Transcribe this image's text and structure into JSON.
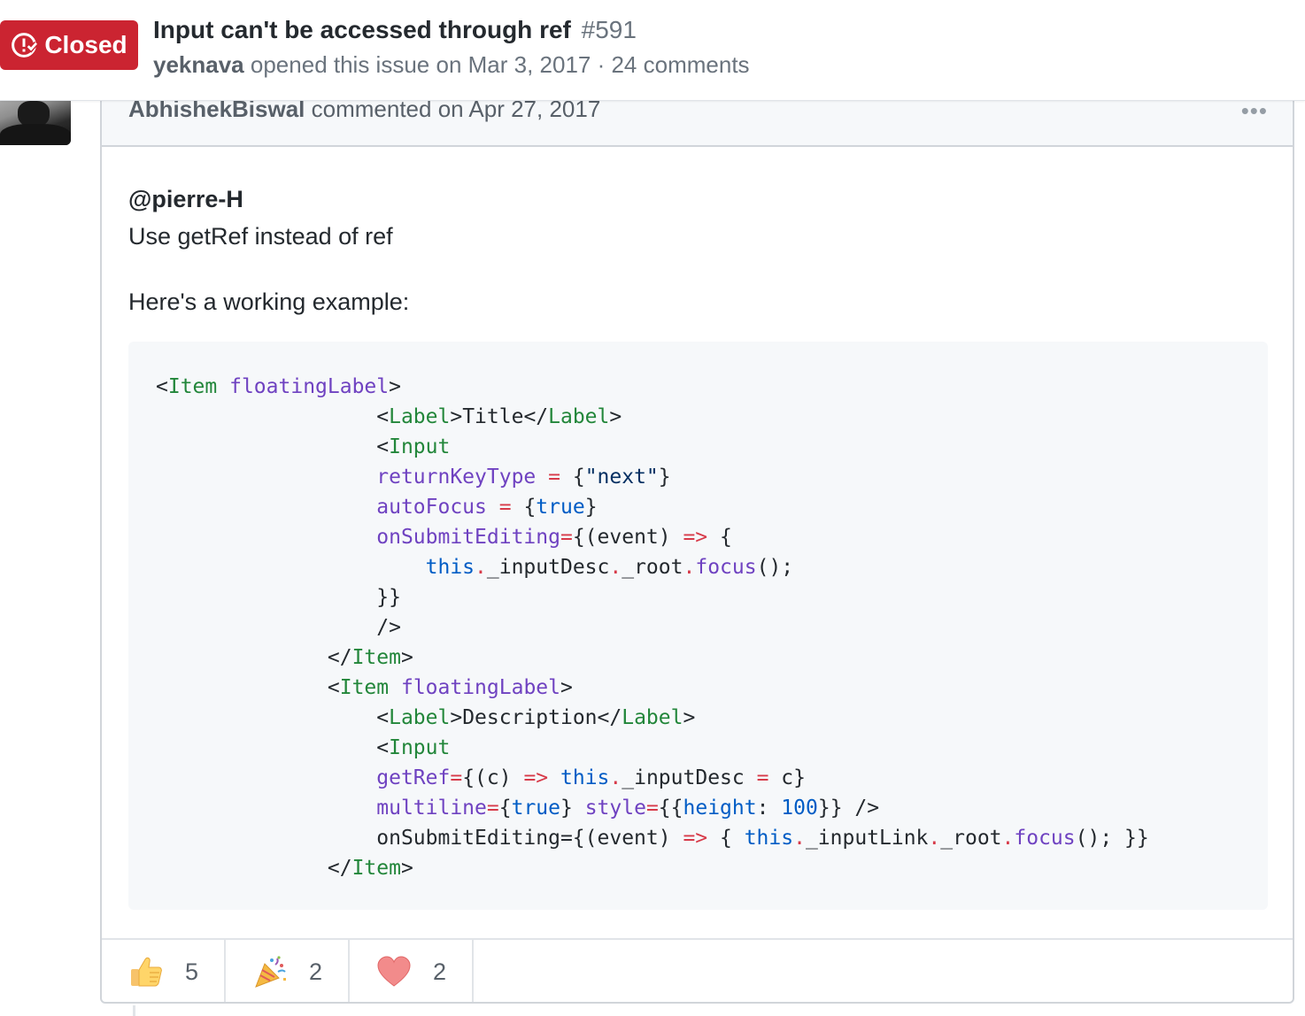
{
  "header": {
    "state_label": "Closed",
    "title": "Input can't be accessed through ref",
    "number": "#591",
    "author": "yeknava",
    "opened_text": "opened this issue on Mar 3, 2017 · 24 comments"
  },
  "comment": {
    "author": "AbhishekBiswal",
    "header_text": "commented on Apr 27, 2017",
    "menu_icon": "kebab-horizontal-icon",
    "mention": "@pierre-H",
    "line1": "Use getRef instead of ref",
    "line2": "Here's a working example:"
  },
  "reactions": [
    {
      "icon": "thumbs-up-icon",
      "count": "5"
    },
    {
      "icon": "tada-icon",
      "count": "2"
    },
    {
      "icon": "heart-icon",
      "count": "2"
    }
  ],
  "colors": {
    "closed_red": "#cb2431",
    "tag_green": "#22863a",
    "attr_purple": "#6f42c1",
    "keyword_red": "#d73a49",
    "constant_blue": "#005cc5",
    "string_navy": "#032f62"
  }
}
